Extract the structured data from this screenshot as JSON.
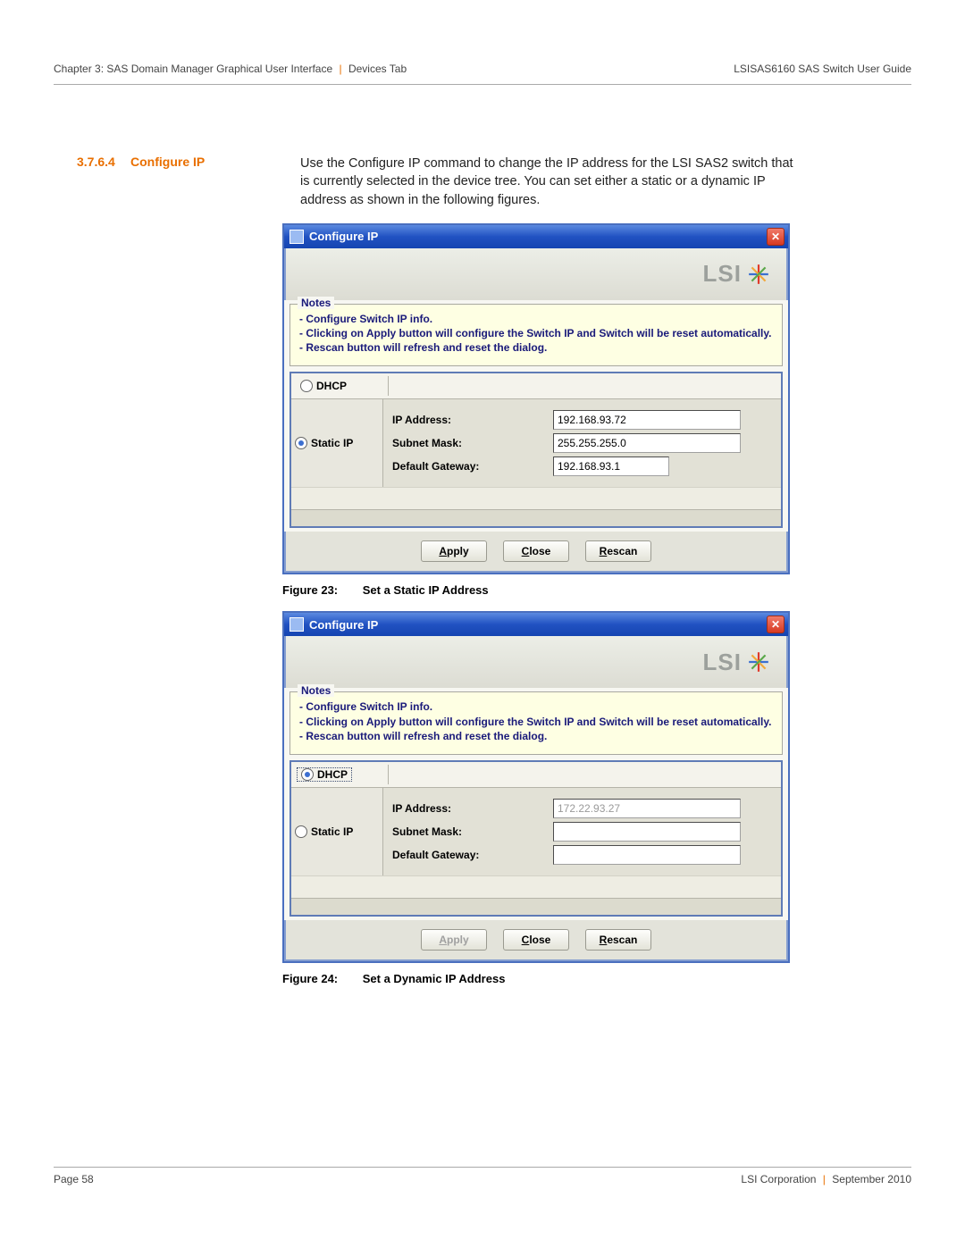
{
  "header": {
    "left_chapter": "Chapter 3: SAS Domain Manager Graphical User Interface",
    "left_tab": "Devices Tab",
    "right": "LSISAS6160 SAS Switch User Guide"
  },
  "section": {
    "number": "3.7.6.4",
    "title": "Configure IP",
    "body": "Use the Configure IP command to change the IP address for the LSI SAS2 switch that is currently selected in the device tree. You can set either a static or a dynamic IP address as shown in the following figures."
  },
  "dialog": {
    "title": "Configure IP",
    "logo_text": "LSI",
    "notes_legend": "Notes",
    "notes_line1": "- Configure Switch IP info.",
    "notes_line2": "- Clicking on Apply button will configure the Switch IP and Switch will be reset automatically.",
    "notes_line3": "- Rescan button will refresh and reset the dialog.",
    "radio_dhcp": "DHCP",
    "radio_static": "Static IP",
    "ip_label": "IP Address:",
    "subnet_label": "Subnet Mask:",
    "gateway_label": "Default Gateway:",
    "btn_apply": "pply",
    "btn_apply_u": "A",
    "btn_close": "lose",
    "btn_close_u": "C",
    "btn_rescan": "escan",
    "btn_rescan_u": "R"
  },
  "figure23": {
    "ip": "192.168.93.72",
    "subnet": "255.255.255.0",
    "gateway": "192.168.93.1",
    "caption_num": "Figure 23:",
    "caption_title": "Set a Static IP Address"
  },
  "figure24": {
    "ip": "172.22.93.27",
    "subnet": "",
    "gateway": "",
    "caption_num": "Figure 24:",
    "caption_title": "Set a Dynamic IP Address"
  },
  "footer": {
    "page": "Page 58",
    "right_company": "LSI Corporation",
    "right_date": "September 2010"
  }
}
